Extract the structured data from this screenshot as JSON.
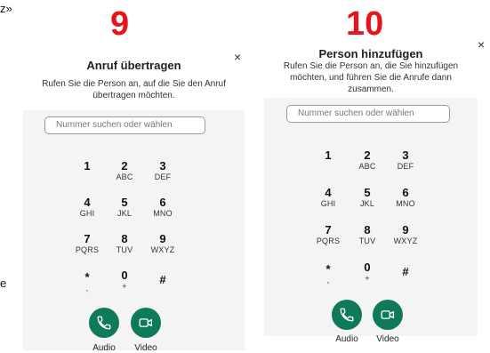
{
  "edge_left_top": "z»",
  "edge_left_mid": "e",
  "panel_left": {
    "step": "9",
    "title": "Anruf übertragen",
    "subtitle_line1": "Rufen Sie die Person an, auf die Sie den Anruf",
    "subtitle_line2": "übertragen möchten.",
    "close": "×",
    "search_placeholder": "Nummer suchen oder wählen",
    "audio_label": "Audio",
    "video_label": "Video"
  },
  "panel_right": {
    "step": "10",
    "title": "Person hinzufügen",
    "subtitle_line1": "Rufen Sie die Person an, die Sie hinzufügen",
    "subtitle_line2": "möchten, und führen Sie die Anrufe dann",
    "subtitle_line3": "zusammen.",
    "close": "×",
    "search_placeholder": "Nummer suchen oder wählen",
    "audio_label": "Audio",
    "video_label": "Video"
  },
  "keypad": [
    {
      "digit": "1",
      "letters": ""
    },
    {
      "digit": "2",
      "letters": "ABC"
    },
    {
      "digit": "3",
      "letters": "DEF"
    },
    {
      "digit": "4",
      "letters": "GHI"
    },
    {
      "digit": "5",
      "letters": "JKL"
    },
    {
      "digit": "6",
      "letters": "MNO"
    },
    {
      "digit": "7",
      "letters": "PQRS"
    },
    {
      "digit": "8",
      "letters": "TUV"
    },
    {
      "digit": "9",
      "letters": "WXYZ"
    },
    {
      "digit": "*",
      "letters": ","
    },
    {
      "digit": "0",
      "letters": "+"
    },
    {
      "digit": "#",
      "letters": ""
    }
  ],
  "colors": {
    "step_number": "#e8141b",
    "call_button": "#0f7a5a",
    "panel_bg": "#f4f4f4"
  },
  "icons": {
    "audio": "phone-icon",
    "video": "video-camera-icon",
    "close": "close-icon"
  }
}
